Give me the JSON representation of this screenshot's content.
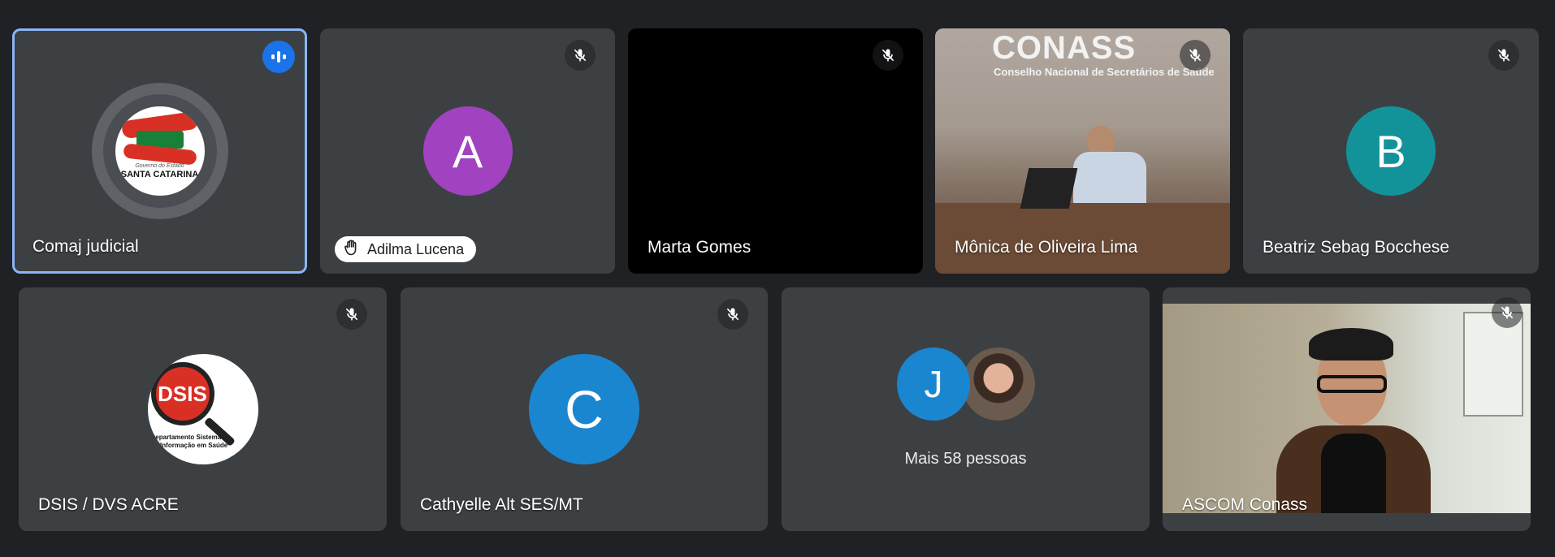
{
  "tiles": [
    {
      "name": "Comaj judicial",
      "logo_text": "SANTA CATARINA",
      "logo_subtext": "Governo do Estado",
      "status": "speaking"
    },
    {
      "name": "Adilma Lucena",
      "avatar_letter": "A",
      "avatar_color": "#a142c0",
      "status": "muted",
      "hand_raised": true
    },
    {
      "name": "Marta Gomes",
      "status": "muted",
      "video": "black"
    },
    {
      "name": "Mônica de Oliveira Lima",
      "status": "muted",
      "video_text_1": "CONASS",
      "video_text_2": "Conselho Nacional de Secretários de Saúde"
    },
    {
      "name": "Beatriz Sebag Bocchese",
      "avatar_letter": "B",
      "avatar_color": "#12939a",
      "status": "muted"
    },
    {
      "name": "DSIS / DVS ACRE",
      "logo_text": "DSIS",
      "logo_subtext_1": "Departamento Sistema",
      "logo_subtext_2": "de Informação em Saúde",
      "status": "muted"
    },
    {
      "name": "Cathyelle Alt SES/MT",
      "avatar_letter": "C",
      "avatar_color": "#1a86d0",
      "status": "muted"
    },
    {
      "others_label": "Mais 58 pessoas",
      "avatar_letter": "J",
      "avatar_color": "#1a86d0"
    },
    {
      "name": "ASCOM Conass",
      "status": "muted"
    }
  ],
  "colors": {
    "background": "#202124",
    "tile": "#3c4043",
    "active_border": "#8ab4f8",
    "speaking": "#1a73e8"
  },
  "icons": [
    "mic-off-icon",
    "speaking-indicator-icon",
    "raised-hand-icon"
  ]
}
